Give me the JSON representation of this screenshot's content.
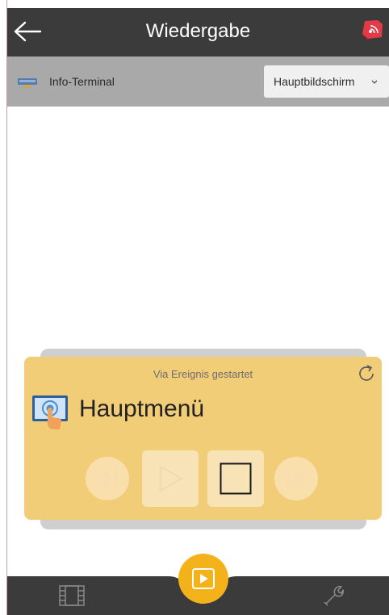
{
  "header": {
    "title": "Wiedergabe",
    "back_icon": "back-arrow-icon",
    "cast_icon": "cast-icon",
    "background": "#3b3b3b"
  },
  "device_bar": {
    "device_label": "Info-Terminal",
    "device_icon": "terminal-icon",
    "screen_select": {
      "selected": "Hauptbildschirm"
    }
  },
  "playback_card": {
    "status": "Via Ereignis gestartet",
    "title": "Hauptmenü",
    "title_icon": "touch-screen-icon",
    "refresh_icon": "refresh-icon",
    "accent": "#f2cd78",
    "controls": [
      {
        "name": "rewind",
        "icon": "rewind-icon"
      },
      {
        "name": "play",
        "icon": "play-icon"
      },
      {
        "name": "stop",
        "icon": "stop-icon"
      },
      {
        "name": "fast-forward",
        "icon": "fast-forward-icon"
      }
    ]
  },
  "bottom_nav": {
    "items": [
      {
        "name": "media",
        "icon": "film-icon"
      },
      {
        "name": "playback",
        "icon": "play-icon",
        "active": true
      },
      {
        "name": "settings",
        "icon": "wrench-icon"
      }
    ],
    "active_color": "#f3b21a"
  }
}
